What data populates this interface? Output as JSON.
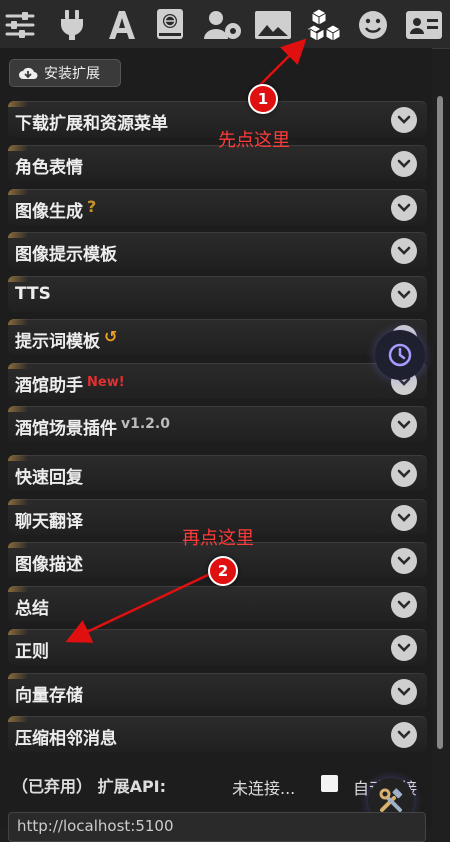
{
  "toolbar": {
    "icons": [
      "sliders-icon",
      "plug-icon",
      "font-icon",
      "book-globe-icon",
      "user-gear-icon",
      "image-icon",
      "cubes-icon",
      "smiley-icon",
      "id-card-icon"
    ]
  },
  "install_button": {
    "label": "安装扩展"
  },
  "rows": [
    {
      "label": "下载扩展和资源菜单"
    },
    {
      "label": "角色表情"
    },
    {
      "label": "图像生成",
      "extra": "?",
      "extra_color": "#c8922a"
    },
    {
      "label": "图像提示模板"
    },
    {
      "label": "TTS"
    },
    {
      "label": "提示词模板",
      "extra": "↺",
      "extra_color": "#f0a020"
    },
    {
      "label": "酒馆助手",
      "extra": "New!",
      "extra_color": "#e03030"
    },
    {
      "label": "酒馆场景插件",
      "extra": "v1.2.0",
      "extra_color": "#bbbbbb"
    },
    {
      "label": "快速回复"
    },
    {
      "label": "聊天翻译"
    },
    {
      "label": "图像描述"
    },
    {
      "label": "总结"
    },
    {
      "label": "正则"
    },
    {
      "label": "向量存储"
    },
    {
      "label": "压缩相邻消息"
    }
  ],
  "annotations": {
    "step1_number": "1",
    "step1_text": "先点这里",
    "step2_number": "2",
    "step2_text": "再点这里"
  },
  "extension_api": {
    "label": "（已弃用） 扩展API:",
    "status": "未连接...",
    "auto_connect_label": "自动连接",
    "url_value": "http://localhost:5100"
  },
  "colors": {
    "accent_red": "#e01010",
    "chevron_bg": "#cfcfcf"
  }
}
